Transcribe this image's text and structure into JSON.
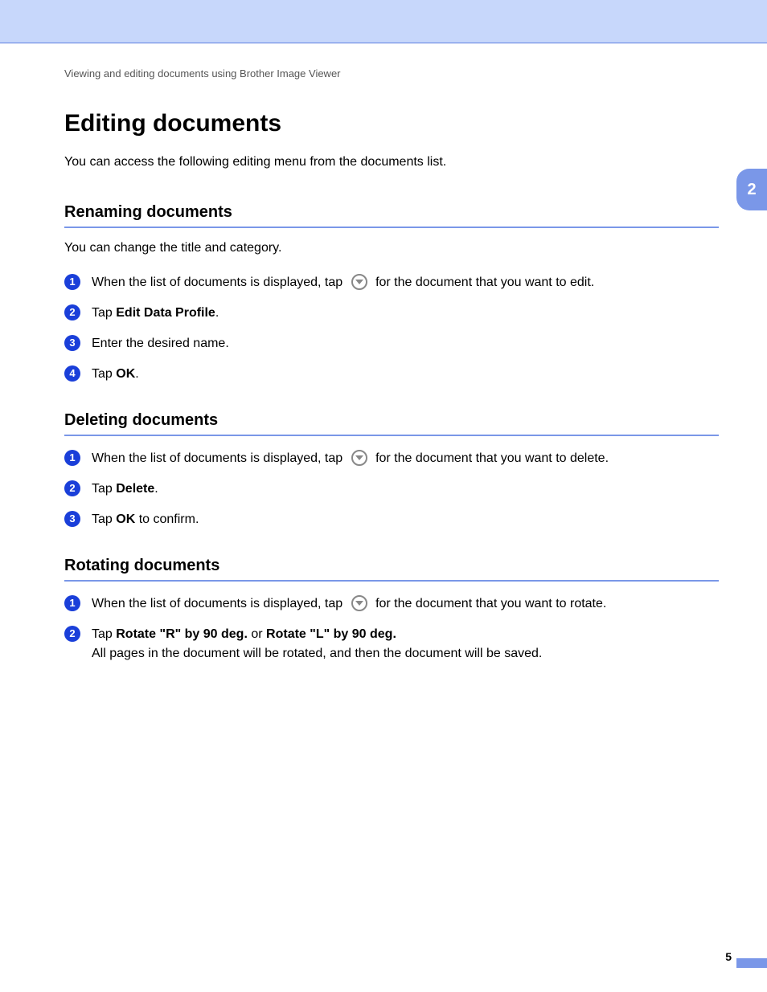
{
  "breadcrumb": "Viewing and editing documents using Brother Image Viewer",
  "page_title": "Editing documents",
  "intro": "You can access the following editing menu from the documents list.",
  "chapter_tab": "2",
  "page_number": "5",
  "sections": {
    "renaming": {
      "heading": "Renaming documents",
      "subtext": "You can change the title and category.",
      "steps": {
        "s1_pre": "When the list of documents is displayed, tap ",
        "s1_post": " for the document that you want to edit.",
        "s2_pre": "Tap ",
        "s2_bold": "Edit Data Profile",
        "s2_post": ".",
        "s3": "Enter the desired name.",
        "s4_pre": "Tap ",
        "s4_bold": "OK",
        "s4_post": "."
      }
    },
    "deleting": {
      "heading": "Deleting documents",
      "steps": {
        "s1_pre": "When the list of documents is displayed, tap ",
        "s1_post": " for the document that you want to delete.",
        "s2_pre": "Tap ",
        "s2_bold": "Delete",
        "s2_post": ".",
        "s3_pre": "Tap ",
        "s3_bold": "OK",
        "s3_post": " to confirm."
      }
    },
    "rotating": {
      "heading": "Rotating documents",
      "steps": {
        "s1_pre": "When the list of documents is displayed, tap ",
        "s1_post": " for the document that you want to rotate.",
        "s2_pre": "Tap ",
        "s2_bold1": "Rotate \"R\" by 90 deg.",
        "s2_mid": " or ",
        "s2_bold2": "Rotate \"L\" by 90 deg.",
        "s2_line2": "All pages in the document will be rotated, and then the document will be saved."
      }
    }
  },
  "bullets": {
    "n1": "1",
    "n2": "2",
    "n3": "3",
    "n4": "4"
  }
}
